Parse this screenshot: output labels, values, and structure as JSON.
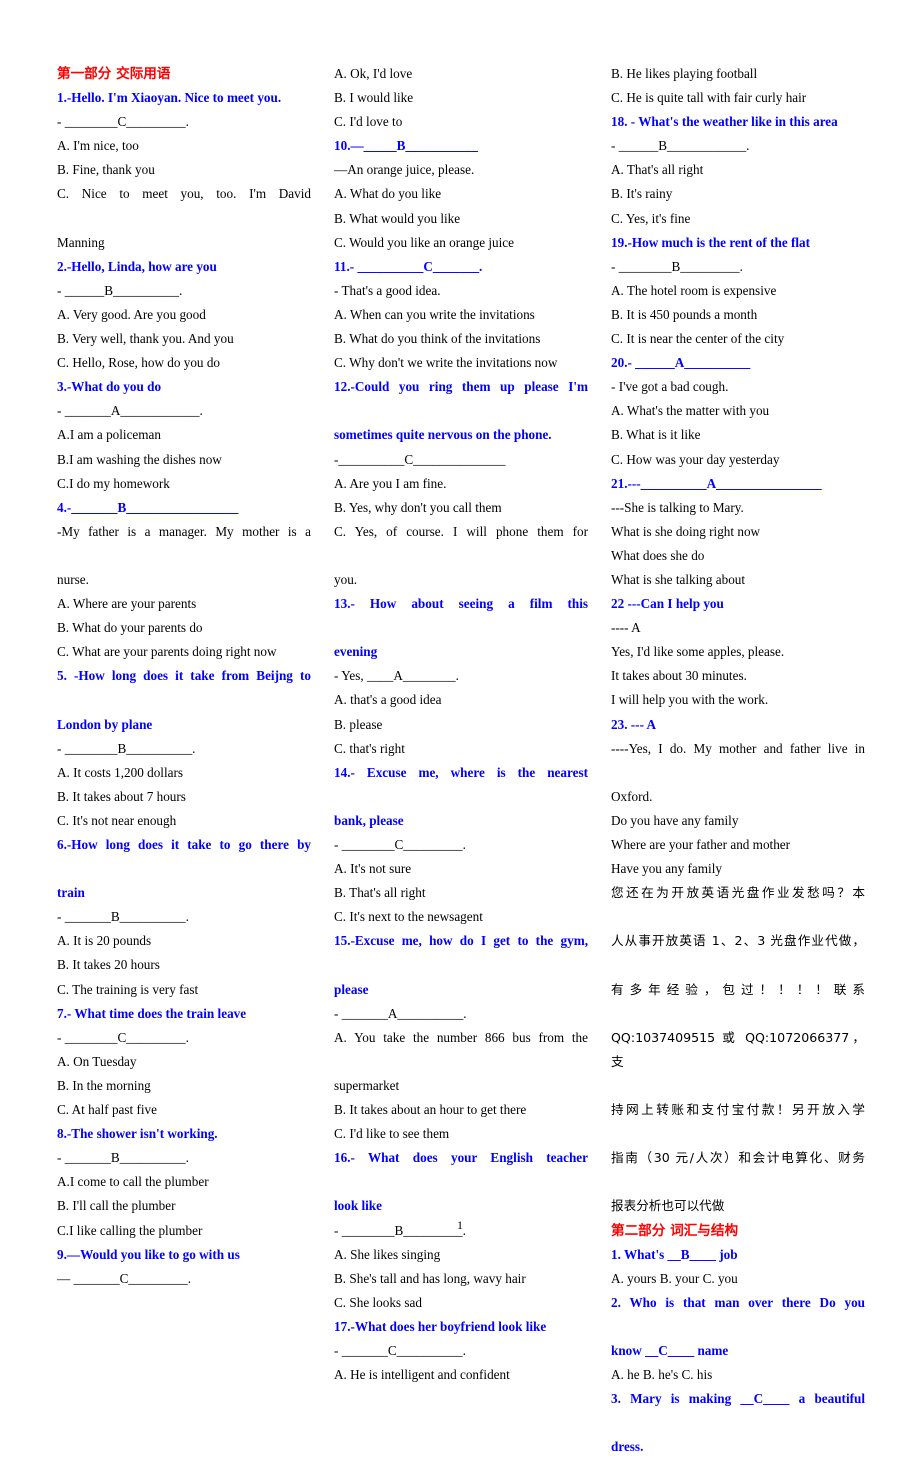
{
  "document": {
    "page_number": "1",
    "colors": {
      "section_header": "#FF0000",
      "question": "#0000FF",
      "body": "#000000"
    }
  },
  "section_one": {
    "header": "第一部分  交际用语"
  },
  "section_two": {
    "header": "第二部分  词汇与结构"
  },
  "column1": [
    {
      "kind": "section-header",
      "text": "第一部分  交际用语"
    },
    {
      "kind": "question",
      "text": "1.-Hello. I'm Xiaoyan. Nice to meet you."
    },
    {
      "kind": "answerline",
      "text": "- ________C_________."
    },
    {
      "kind": "option",
      "text": "A. I'm nice, too"
    },
    {
      "kind": "option",
      "text": "B. Fine, thank you"
    },
    {
      "kind": "option-just",
      "text": "C. Nice to meet you, too. I'm David"
    },
    {
      "kind": "option",
      "text": "Manning"
    },
    {
      "kind": "question",
      "text": "2.-Hello, Linda, how are you"
    },
    {
      "kind": "answerline",
      "text": "- ______B__________."
    },
    {
      "kind": "option",
      "text": "A. Very good. Are you good"
    },
    {
      "kind": "option",
      "text": "B. Very well, thank you. And you"
    },
    {
      "kind": "option",
      "text": "C. Hello, Rose, how do you do"
    },
    {
      "kind": "question",
      "text": "3.-What do you do"
    },
    {
      "kind": "answerline",
      "text": "- _______A____________."
    },
    {
      "kind": "option",
      "text": "A.I am a policeman"
    },
    {
      "kind": "option",
      "text": "B.I am washing the dishes now"
    },
    {
      "kind": "option",
      "text": "C.I do my homework"
    },
    {
      "kind": "question-blank",
      "text": "4.-_______B_________________"
    },
    {
      "kind": "option-just",
      "text": "-My father is a manager. My mother is a"
    },
    {
      "kind": "option",
      "text": "nurse."
    },
    {
      "kind": "option",
      "text": "A. Where are your parents"
    },
    {
      "kind": "option",
      "text": "B. What do your parents do"
    },
    {
      "kind": "option",
      "text": "C. What are your parents doing right now"
    },
    {
      "kind": "question-just",
      "text": "5. -How long does it take from Beijng to"
    },
    {
      "kind": "question",
      "text": "London by plane"
    },
    {
      "kind": "answerline",
      "text": "- ________B__________."
    },
    {
      "kind": "option",
      "text": "A. It costs 1,200 dollars"
    },
    {
      "kind": "option",
      "text": "B. It takes about 7 hours"
    },
    {
      "kind": "option",
      "text": "C. It's not near enough"
    },
    {
      "kind": "question-just",
      "text": "6.-How long does it take to go there by"
    },
    {
      "kind": "question",
      "text": "train"
    },
    {
      "kind": "answerline",
      "text": "- _______B__________."
    },
    {
      "kind": "option",
      "text": "A. It is 20 pounds"
    },
    {
      "kind": "option",
      "text": "B. It takes 20 hours"
    },
    {
      "kind": "option",
      "text": "C. The training is very fast"
    },
    {
      "kind": "question",
      "text": "7.- What time does the train leave"
    },
    {
      "kind": "answerline",
      "text": "- ________C_________."
    },
    {
      "kind": "option",
      "text": "A. On Tuesday"
    },
    {
      "kind": "option",
      "text": "B. In the morning"
    },
    {
      "kind": "option",
      "text": "C. At half past five"
    },
    {
      "kind": "question",
      "text": "8.-The shower isn't working."
    },
    {
      "kind": "answerline",
      "text": "- _______B__________."
    },
    {
      "kind": "option",
      "text": "A.I come to call the plumber"
    },
    {
      "kind": "option",
      "text": "B. I'll call the plumber"
    },
    {
      "kind": "option",
      "text": "C.I like calling the plumber"
    },
    {
      "kind": "question",
      "text": "9.—Would you like to go with us"
    },
    {
      "kind": "answerline",
      "text": "— _______C_________."
    }
  ],
  "column2": [
    {
      "kind": "option",
      "text": "A. Ok, I'd love"
    },
    {
      "kind": "option",
      "text": "B. I would like"
    },
    {
      "kind": "option",
      "text": "C. I'd love to"
    },
    {
      "kind": "question-blank",
      "text": "10.—_____B___________"
    },
    {
      "kind": "option",
      "text": "—An orange juice, please."
    },
    {
      "kind": "option",
      "text": "A. What do you like"
    },
    {
      "kind": "option",
      "text": "B. What would you like"
    },
    {
      "kind": "option",
      "text": "C. Would you like an orange juice"
    },
    {
      "kind": "question-blank",
      "text": "11.- __________C_______."
    },
    {
      "kind": "option",
      "text": "- That's a good idea."
    },
    {
      "kind": "option",
      "text": "A. When can you write the invitations"
    },
    {
      "kind": "option",
      "text": "B. What do you think of the invitations"
    },
    {
      "kind": "option",
      "text": "C. Why don't we write the invitations now"
    },
    {
      "kind": "question-just",
      "text": "12.-Could you ring them up please I'm"
    },
    {
      "kind": "question",
      "text": "sometimes quite nervous on the phone."
    },
    {
      "kind": "answerline",
      "text": "-__________C______________"
    },
    {
      "kind": "option",
      "text": "A. Are you I am fine."
    },
    {
      "kind": "option",
      "text": "B. Yes, why don't you call them"
    },
    {
      "kind": "option-just",
      "text": "C. Yes, of course. I will phone them for"
    },
    {
      "kind": "option",
      "text": "you."
    },
    {
      "kind": "question-just",
      "text": "13.- How about seeing a film this"
    },
    {
      "kind": "question",
      "text": "evening"
    },
    {
      "kind": "answerline",
      "text": "- Yes, ____A________."
    },
    {
      "kind": "option",
      "text": "A. that's a good idea"
    },
    {
      "kind": "option",
      "text": "B. please"
    },
    {
      "kind": "option",
      "text": "C. that's right"
    },
    {
      "kind": "question-just",
      "text": "14.- Excuse me, where is the nearest"
    },
    {
      "kind": "question",
      "text": "bank, please"
    },
    {
      "kind": "answerline",
      "text": "- ________C_________."
    },
    {
      "kind": "option",
      "text": "A. It's not sure"
    },
    {
      "kind": "option",
      "text": "B. That's all right"
    },
    {
      "kind": "option",
      "text": "C. It's next to the newsagent"
    },
    {
      "kind": "question-just",
      "text": "15.-Excuse me, how do I get to the gym,"
    },
    {
      "kind": "question",
      "text": "please"
    },
    {
      "kind": "answerline",
      "text": "- _______A__________."
    },
    {
      "kind": "option-just",
      "text": "A. You take the number 866 bus from the"
    },
    {
      "kind": "option",
      "text": "supermarket"
    },
    {
      "kind": "option",
      "text": "B. It takes about an hour to get there"
    },
    {
      "kind": "option",
      "text": "C. I'd like to see them"
    },
    {
      "kind": "question-just",
      "text": "16.- What does your English teacher"
    },
    {
      "kind": "question",
      "text": "look like"
    },
    {
      "kind": "answerline",
      "text": "- ________B_________."
    },
    {
      "kind": "option",
      "text": "A. She likes singing"
    },
    {
      "kind": "option",
      "text": "B. She's tall and has long, wavy hair"
    },
    {
      "kind": "option",
      "text": "C. She looks sad"
    },
    {
      "kind": "question",
      "text": "17.-What does her boyfriend look like"
    },
    {
      "kind": "answerline",
      "text": "- _______C__________."
    },
    {
      "kind": "option",
      "text": "A. He is intelligent and confident"
    }
  ],
  "column3": [
    {
      "kind": "option",
      "text": "B. He likes playing football"
    },
    {
      "kind": "option",
      "text": "C. He is quite tall with fair curly hair"
    },
    {
      "kind": "question",
      "text": "18. - What's the weather like in this area"
    },
    {
      "kind": "answerline",
      "text": "- ______B____________."
    },
    {
      "kind": "option",
      "text": "A. That's all right"
    },
    {
      "kind": "option",
      "text": "B. It's rainy"
    },
    {
      "kind": "option",
      "text": "C. Yes, it's fine"
    },
    {
      "kind": "question",
      "text": "19.-How much is the rent of the flat"
    },
    {
      "kind": "answerline",
      "text": "- ________B_________."
    },
    {
      "kind": "option",
      "text": "A. The hotel room is expensive"
    },
    {
      "kind": "option",
      "text": "B. It is 450 pounds a month"
    },
    {
      "kind": "option",
      "text": "C. It is near the center of the city"
    },
    {
      "kind": "question-blank",
      "text": "20.- ______A__________"
    },
    {
      "kind": "option",
      "text": "- I've got a bad cough."
    },
    {
      "kind": "option",
      "text": "A. What's the matter with you"
    },
    {
      "kind": "option",
      "text": "B. What is it like"
    },
    {
      "kind": "option",
      "text": "C. How was your day yesterday"
    },
    {
      "kind": "question-blank",
      "text": "21.---__________A________________"
    },
    {
      "kind": "option",
      "text": "---She is talking to Mary."
    },
    {
      "kind": "option",
      "text": "What is she doing right now"
    },
    {
      "kind": "option",
      "text": "What does she do"
    },
    {
      "kind": "option",
      "text": "What is she talking about"
    },
    {
      "kind": "question",
      "text": "22 ---Can I help you"
    },
    {
      "kind": "option",
      "text": "---- A"
    },
    {
      "kind": "option",
      "text": "Yes, I'd like some apples, please."
    },
    {
      "kind": "option",
      "text": "It takes about 30 minutes."
    },
    {
      "kind": "option",
      "text": "I will help you with the work."
    },
    {
      "kind": "question",
      "text": "23. --- A"
    },
    {
      "kind": "option-just",
      "text": "----Yes, I do. My mother and father live in"
    },
    {
      "kind": "option",
      "text": "Oxford."
    },
    {
      "kind": "option",
      "text": "Do you have any family"
    },
    {
      "kind": "option",
      "text": "Where are your father and mother"
    },
    {
      "kind": "option",
      "text": "Have you any family"
    },
    {
      "kind": "cn-just",
      "text": "您还在为开放英语光盘作业发愁吗？本"
    },
    {
      "kind": "cn-just",
      "text": "人从事开放英语 1、2、3 光盘作业代做，"
    },
    {
      "kind": "cn-just",
      "text": "有多年经验，包过！！！！联系"
    },
    {
      "kind": "cn-just",
      "text": "QQ:1037409515 或 QQ:1072066377，支"
    },
    {
      "kind": "cn-just",
      "text": "持网上转账和支付宝付款！另开放入学"
    },
    {
      "kind": "cn-just",
      "text": "指南（30 元/人次）和会计电算化、财务"
    },
    {
      "kind": "cn",
      "text": "报表分析也可以代做"
    },
    {
      "kind": "section-header",
      "text": "第二部分  词汇与结构"
    },
    {
      "kind": "question",
      "text": "1. What's __B____ job"
    },
    {
      "kind": "option",
      "text": "A. yours B. your C. you"
    },
    {
      "kind": "question-just",
      "text": "2. Who is that man over there Do you"
    },
    {
      "kind": "question",
      "text": "know __C____ name"
    },
    {
      "kind": "option",
      "text": "A. he B. he's C. his"
    },
    {
      "kind": "question-just",
      "text": "3. Mary is making __C____ a beautiful"
    },
    {
      "kind": "question",
      "text": "dress."
    }
  ]
}
